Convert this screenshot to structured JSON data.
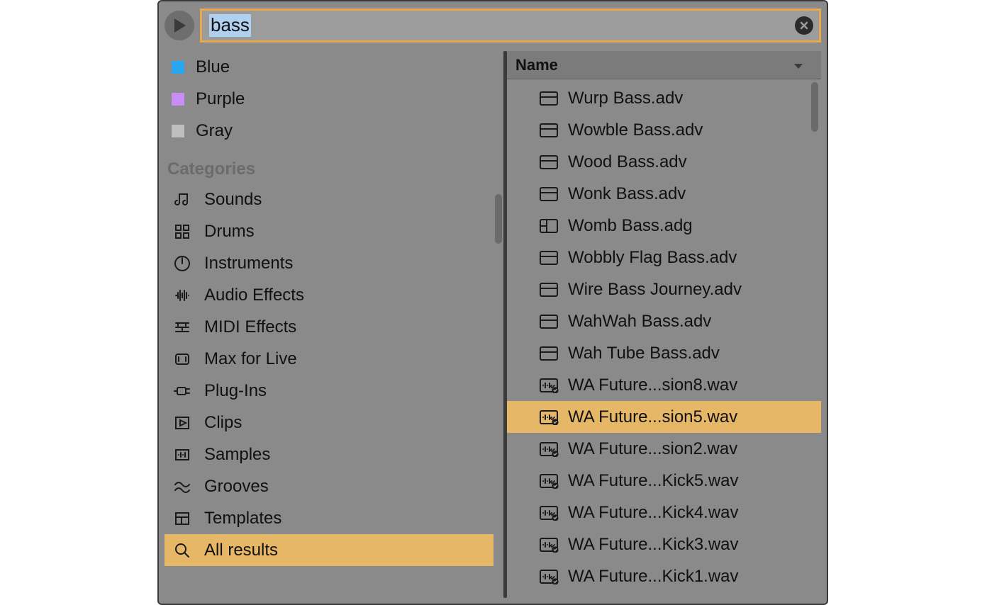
{
  "search": {
    "value": "bass"
  },
  "color_tags": [
    {
      "label": "Blue",
      "color": "#2aa5ef"
    },
    {
      "label": "Purple",
      "color": "#c88ef5"
    },
    {
      "label": "Gray",
      "color": "#bfbfbf"
    }
  ],
  "categories_header": "Categories",
  "categories": [
    {
      "label": "Sounds",
      "icon": "sounds"
    },
    {
      "label": "Drums",
      "icon": "drums"
    },
    {
      "label": "Instruments",
      "icon": "instruments"
    },
    {
      "label": "Audio Effects",
      "icon": "audiofx"
    },
    {
      "label": "MIDI Effects",
      "icon": "midifx"
    },
    {
      "label": "Max for Live",
      "icon": "max"
    },
    {
      "label": "Plug-Ins",
      "icon": "plugins"
    },
    {
      "label": "Clips",
      "icon": "clips"
    },
    {
      "label": "Samples",
      "icon": "samples"
    },
    {
      "label": "Grooves",
      "icon": "grooves"
    },
    {
      "label": "Templates",
      "icon": "templates"
    },
    {
      "label": "All results",
      "icon": "search",
      "selected": true
    }
  ],
  "results_header": "Name",
  "results": [
    {
      "label": "Wurp Bass.adv",
      "icon": "preset"
    },
    {
      "label": "Wowble Bass.adv",
      "icon": "preset"
    },
    {
      "label": "Wood Bass.adv",
      "icon": "preset"
    },
    {
      "label": "Wonk Bass.adv",
      "icon": "preset"
    },
    {
      "label": "Womb Bass.adg",
      "icon": "rack"
    },
    {
      "label": "Wobbly Flag Bass.adv",
      "icon": "preset"
    },
    {
      "label": "Wire Bass Journey.adv",
      "icon": "preset"
    },
    {
      "label": "WahWah Bass.adv",
      "icon": "preset"
    },
    {
      "label": "Wah Tube Bass.adv",
      "icon": "preset"
    },
    {
      "label": "WA Future...sion8.wav",
      "icon": "wav"
    },
    {
      "label": "WA Future...sion5.wav",
      "icon": "wav",
      "selected": true
    },
    {
      "label": "WA Future...sion2.wav",
      "icon": "wav"
    },
    {
      "label": "WA Future...Kick5.wav",
      "icon": "wav"
    },
    {
      "label": "WA Future...Kick4.wav",
      "icon": "wav"
    },
    {
      "label": "WA Future...Kick3.wav",
      "icon": "wav"
    },
    {
      "label": "WA Future...Kick1.wav",
      "icon": "wav"
    }
  ]
}
